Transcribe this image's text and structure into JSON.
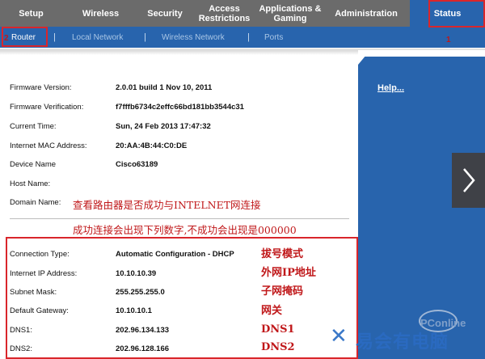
{
  "menu": {
    "items": [
      "Setup",
      "Wireless",
      "Security",
      "Access Restrictions",
      "Applications & Gaming",
      "Administration"
    ],
    "status": "Status"
  },
  "submenu": {
    "items": [
      "Router",
      "Local Network",
      "Wireless Network",
      "Ports"
    ],
    "separator": "|"
  },
  "sidebar": {
    "help": "Help..."
  },
  "router_info": [
    {
      "label": "Firmware Version:",
      "value": "2.0.01 build 1  Nov 10, 2011"
    },
    {
      "label": "Firmware Verification:",
      "value": "f7fffb6734c2effc66bd181bb3544c31"
    },
    {
      "label": "Current Time:",
      "value": "Sun, 24 Feb 2013 17:47:32"
    },
    {
      "label": "Internet MAC Address:",
      "value": "20:AA:4B:44:C0:DE"
    },
    {
      "label": "Device Name",
      "value": "Cisco63189"
    },
    {
      "label": "Host Name:",
      "value": ""
    },
    {
      "label": "Domain Name:",
      "value": ""
    }
  ],
  "connection_info": [
    {
      "label": "Connection Type:",
      "value": "Automatic Configuration - DHCP",
      "note": "拔号模式"
    },
    {
      "label": "Internet IP Address:",
      "value": "10.10.10.39",
      "note": "外网IP地址"
    },
    {
      "label": "Subnet Mask:",
      "value": "255.255.255.0",
      "note": "子网掩码"
    },
    {
      "label": "Default Gateway:",
      "value": "10.10.10.1",
      "note": "网关"
    },
    {
      "label": "DNS1:",
      "value": "202.96.134.133",
      "note": "DNS1"
    },
    {
      "label": "DNS2:",
      "value": "202.96.128.166",
      "note": "DNS2"
    }
  ],
  "annotations": {
    "line1": "查看路由器是否成功与INTELNET网连接",
    "line2": "成功连接会出现下列数字,不成功会出现是000000",
    "marker1": "1",
    "marker2": "2"
  },
  "watermark": {
    "brand": "PConline",
    "text": "易会有电脑"
  },
  "colors": {
    "nav_blue": "#2864ad",
    "menu_gray": "#6b6b6b",
    "annotation_red": "#c0181a"
  }
}
